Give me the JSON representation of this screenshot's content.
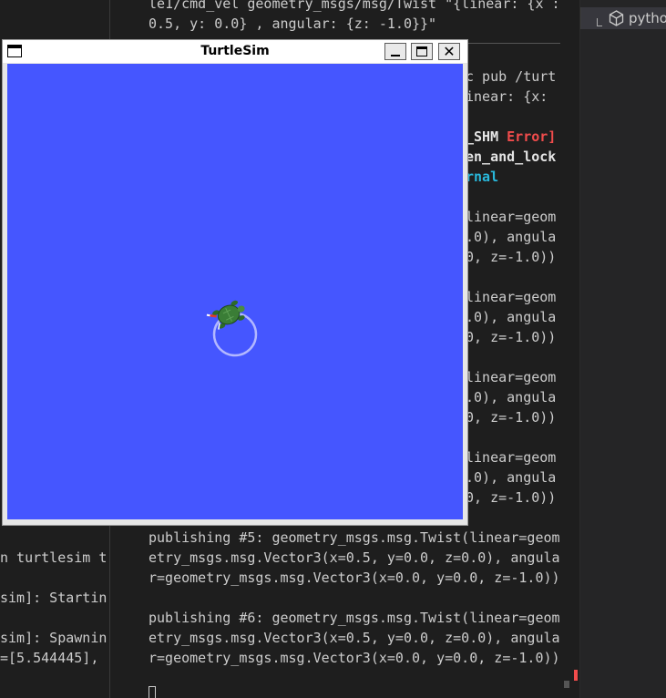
{
  "left_terminal": {
    "lines": [
      "n turtlesim t",
      "sim]: Startin",
      "sim]: Spawnin",
      "=[5.544445],"
    ]
  },
  "center_terminal": {
    "top_lines": [
      "le1/cmd_vel geometry_msgs/msg/Twist \"{linear: {x :",
      "0.5, y: 0.0} , angular: {z: -1.0}}\""
    ],
    "partial_lines": [
      "c pub /turt",
      "inear: {x:"
    ],
    "error_prefix": "_SHM ",
    "error_word": "Error]",
    "bold_line": "en_and_lock",
    "cyan_line": "rnal",
    "blocks_partial": [
      [
        "linear=geom",
        ".0), angula",
        "0, z=-1.0))"
      ],
      [
        "linear=geom",
        ".0), angula",
        "0, z=-1.0))"
      ],
      [
        "linear=geom",
        ".0), angula",
        "0, z=-1.0))"
      ],
      [
        "linear=geom",
        ".0), angula",
        "0, z=-1.0))"
      ]
    ],
    "blocks_full": [
      [
        "publishing #5: geometry_msgs.msg.Twist(linear=geom",
        "etry_msgs.msg.Vector3(x=0.5, y=0.0, z=0.0), angula",
        "r=geometry_msgs.msg.Vector3(x=0.0, y=0.0, z=-1.0))"
      ],
      [
        "publishing #6: geometry_msgs.msg.Twist(linear=geom",
        "etry_msgs.msg.Vector3(x=0.5, y=0.0, z=0.0), angula",
        "r=geometry_msgs.msg.Vector3(x=0.0, y=0.0, z=-1.0))"
      ]
    ]
  },
  "sidebar": {
    "item_label": "pytho",
    "item_icon": "cube-icon"
  },
  "turtlesim": {
    "title": "TurtleSim",
    "background_color": "#4556ff",
    "trail_color": "#b3b8ff",
    "turtle_color": "#3a7d36",
    "icons": [
      "app-icon",
      "minimize-icon",
      "maximize-icon",
      "close-icon"
    ],
    "close_glyph": "✕"
  },
  "colors": {
    "terminal_bg": "#1e1e1e",
    "error": "#f14c4c",
    "cyan": "#29b8db"
  }
}
